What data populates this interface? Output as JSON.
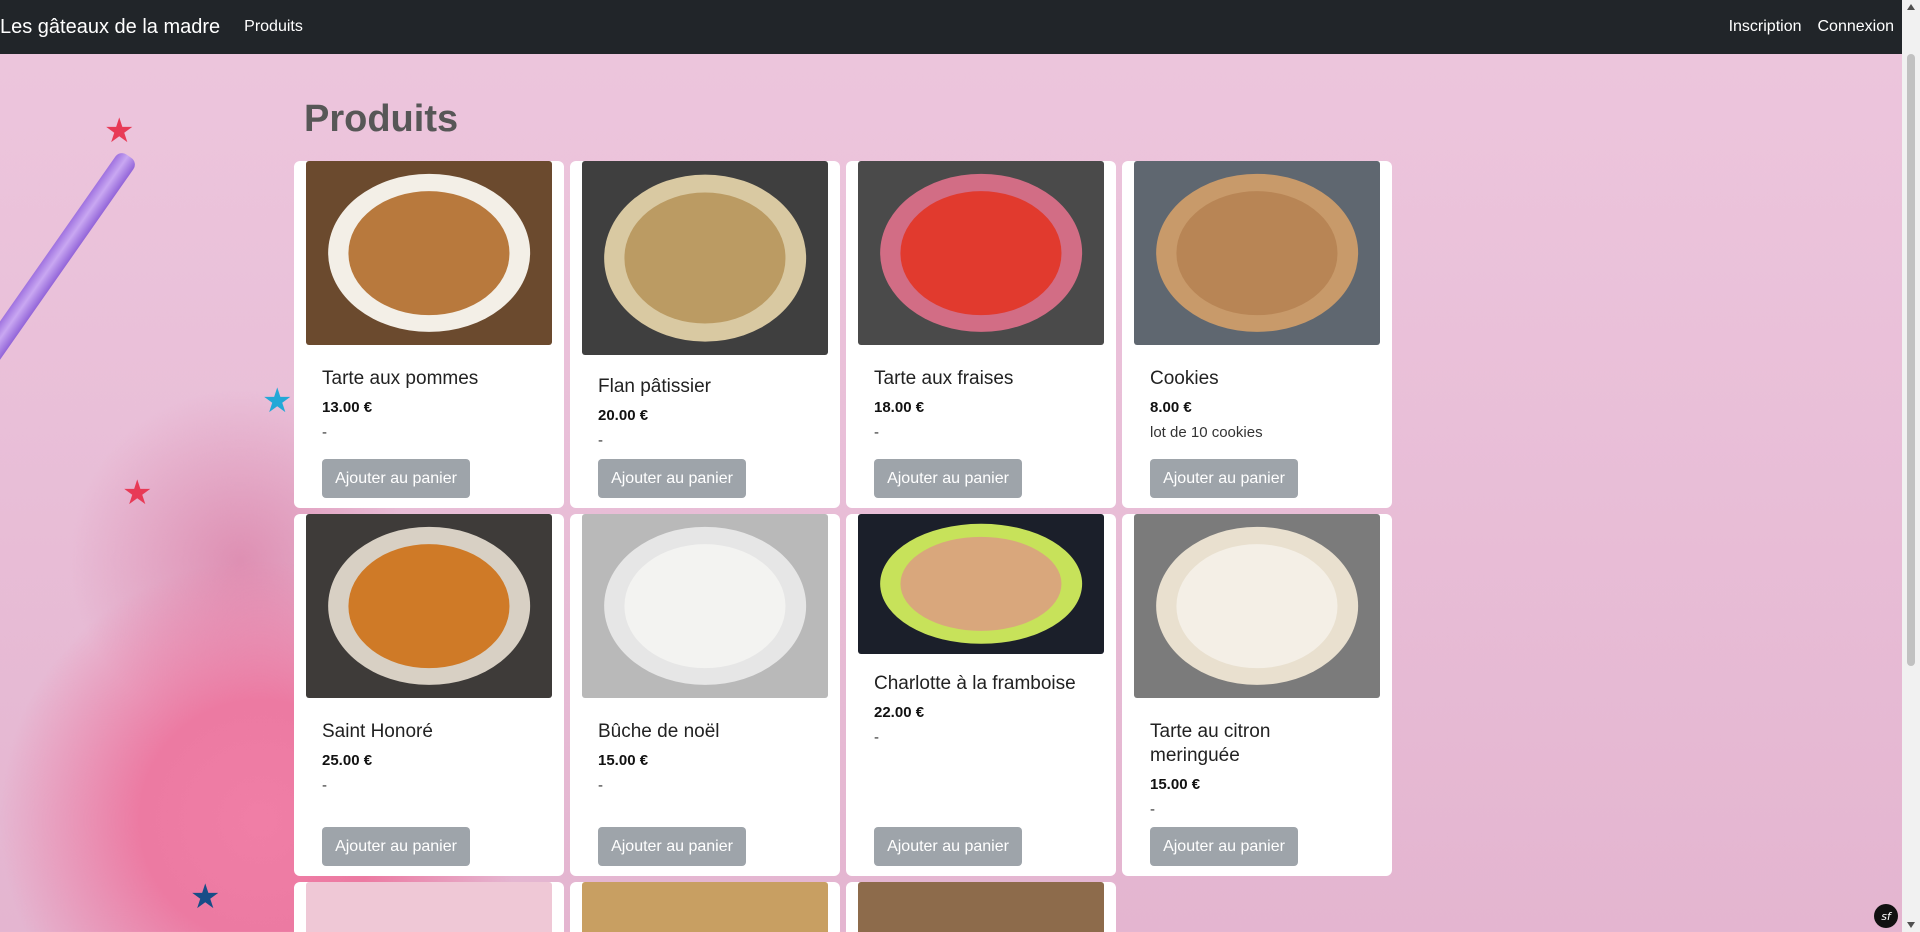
{
  "navbar": {
    "brand": "Les gâteaux de la madre",
    "products_link": "Produits",
    "register_link": "Inscription",
    "login_link": "Connexion"
  },
  "page": {
    "title": "Produits"
  },
  "products": [
    {
      "title": "Tarte aux pommes",
      "price": "13.00 €",
      "description": "-",
      "button": "Ajouter au panier",
      "colors": {
        "bg": "#6b4a2e",
        "plate": "#f3efe7",
        "food": "#b8793d"
      }
    },
    {
      "title": "Flan pâtissier",
      "price": "20.00 €",
      "description": "-",
      "button": "Ajouter au panier",
      "colors": {
        "bg": "#3f3f3f",
        "plate": "#d9c9a2",
        "food": "#bb9b63"
      }
    },
    {
      "title": "Tarte aux fraises",
      "price": "18.00 €",
      "description": "-",
      "button": "Ajouter au panier",
      "colors": {
        "bg": "#4a4a4a",
        "plate": "#d26d85",
        "food": "#e13a2e"
      }
    },
    {
      "title": "Cookies",
      "price": "8.00 €",
      "description": "lot de 10 cookies",
      "button": "Ajouter au panier",
      "colors": {
        "bg": "#5f6770",
        "plate": "#c89a6a",
        "food": "#b88555"
      }
    },
    {
      "title": "Saint Honoré",
      "price": "25.00 €",
      "description": "-",
      "button": "Ajouter au panier",
      "colors": {
        "bg": "#3e3b39",
        "plate": "#d8d0c4",
        "food": "#cf7a27"
      }
    },
    {
      "title": "Bûche de noël",
      "price": "15.00 €",
      "description": "-",
      "button": "Ajouter au panier",
      "colors": {
        "bg": "#b9b9b9",
        "plate": "#e6e6e6",
        "food": "#f3f3f1"
      }
    },
    {
      "title": "Charlotte à la framboise",
      "price": "22.00 €",
      "description": "-",
      "button": "Ajouter au panier",
      "colors": {
        "bg": "#1b1f2a",
        "plate": "#c7e25a",
        "food": "#d9a77c"
      }
    },
    {
      "title": "Tarte au citron meringuée",
      "price": "15.00 €",
      "description": "-",
      "button": "Ajouter au panier",
      "colors": {
        "bg": "#7b7b7b",
        "plate": "#e9e0cf",
        "food": "#f4efe6"
      }
    }
  ],
  "row3": [
    {
      "colors": {
        "bg": "#efc8d6"
      }
    },
    {
      "colors": {
        "bg": "#c89f62"
      }
    },
    {
      "colors": {
        "bg": "#8d6b4b"
      }
    }
  ],
  "symfony_badge": "sf"
}
